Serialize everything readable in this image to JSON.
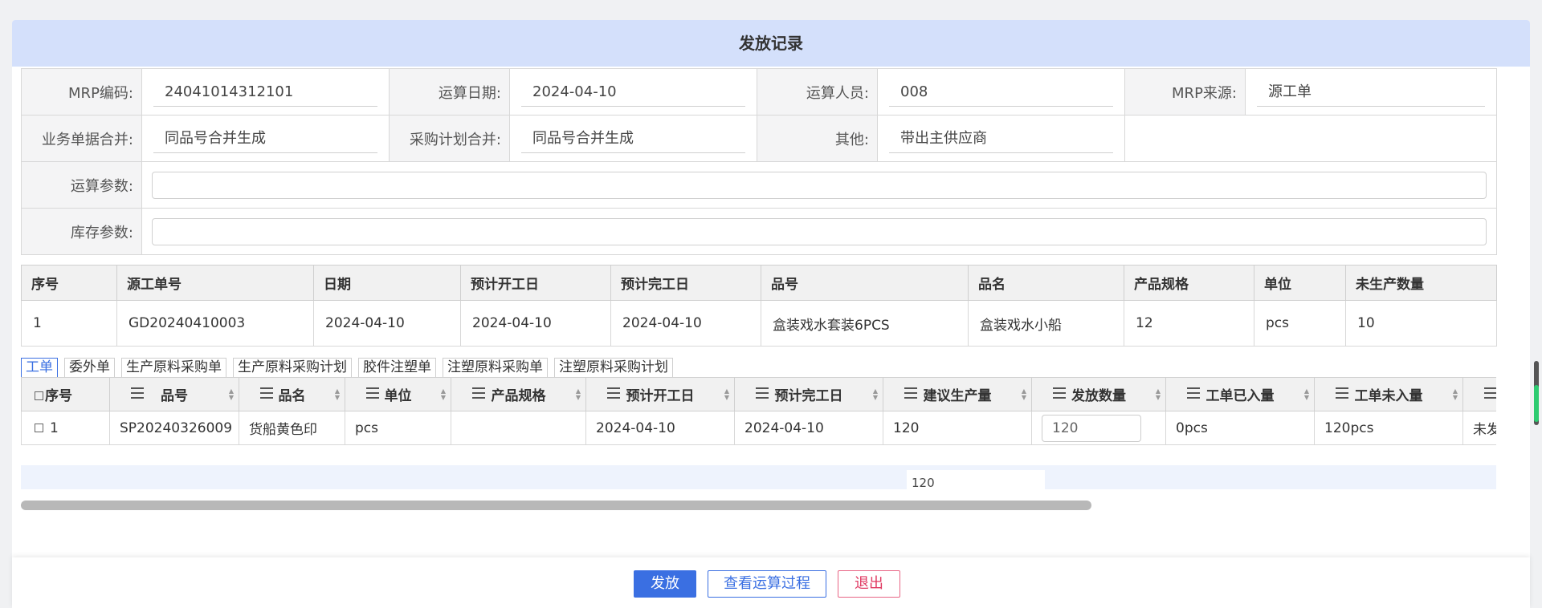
{
  "dialog": {
    "title": "发放记录"
  },
  "form": {
    "mrp_code_label": "MRP编码:",
    "mrp_code": "24041014312101",
    "calc_date_label": "运算日期:",
    "calc_date": "2024-04-10",
    "operator_label": "运算人员:",
    "operator": "008",
    "mrp_source_label": "MRP来源:",
    "mrp_source": "源工单",
    "biz_merge_label": "业务单据合并:",
    "biz_merge": "同品号合并生成",
    "purchase_merge_label": "采购计划合并:",
    "purchase_merge": "同品号合并生成",
    "other_label": "其他:",
    "other": "带出主供应商",
    "calc_params_label": "运算参数:",
    "calc_params": "",
    "stock_params_label": "库存参数:",
    "stock_params": ""
  },
  "source_table": {
    "headers": [
      "序号",
      "源工单号",
      "日期",
      "预计开工日",
      "预计完工日",
      "品号",
      "品名",
      "产品规格",
      "单位",
      "未生产数量"
    ],
    "rows": [
      [
        "1",
        "GD20240410003",
        "2024-04-10",
        "2024-04-10",
        "2024-04-10",
        "盒装戏水套装6PCS",
        "盒装戏水小船",
        "12",
        "pcs",
        "10"
      ]
    ]
  },
  "tabs": [
    "工单",
    "委外单",
    "生产原料采购单",
    "生产原料采购计划",
    "胶件注塑单",
    "注塑原料采购单",
    "注塑原料采购计划"
  ],
  "detail_grid": {
    "headers": [
      "序号",
      "品号",
      "品名",
      "单位",
      "产品规格",
      "预计开工日",
      "预计完工日",
      "建议生产量",
      "发放数量",
      "工单已入量",
      "工单未入量"
    ],
    "row": {
      "seq": "1",
      "item_no": "SP20240326009",
      "item_name": "货船黄色印",
      "unit": "pcs",
      "spec": "",
      "start": "2024-04-10",
      "end": "2024-04-10",
      "suggest": "120",
      "release_qty": "120",
      "stocked": "0pcs",
      "unstocked": "120pcs",
      "overflow": "未发"
    },
    "footer_sum": "120"
  },
  "buttons": {
    "release": "发放",
    "view_process": "查看运算过程",
    "exit": "退出"
  }
}
